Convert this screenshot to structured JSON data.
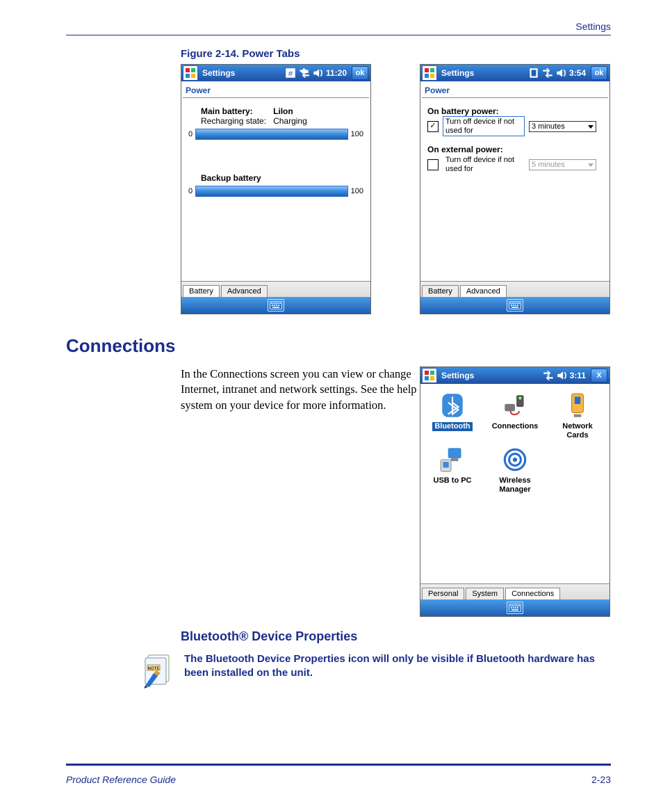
{
  "header": {
    "right": "Settings"
  },
  "figure": {
    "caption": "Figure 2-14. Power Tabs"
  },
  "screen_battery": {
    "title": "Settings",
    "time": "11:20",
    "ok": "ok",
    "section": "Power",
    "main_label": "Main battery:",
    "main_type": "LiIon",
    "recharge_label": "Recharging state:",
    "recharge_value": "Charging",
    "scale_min": "0",
    "scale_max": "100",
    "backup_label": "Backup battery",
    "tabs": [
      "Battery",
      "Advanced"
    ],
    "active_tab": 0
  },
  "screen_advanced": {
    "title": "Settings",
    "time": "3:54",
    "ok": "ok",
    "section": "Power",
    "bat_label": "On battery power:",
    "bat_option": "Turn off device if not used for",
    "bat_select": "3 minutes",
    "ext_label": "On external power:",
    "ext_option": "Turn off device if not used for",
    "ext_select": "5 minutes",
    "tabs": [
      "Battery",
      "Advanced"
    ],
    "active_tab": 1
  },
  "connections_heading": "Connections",
  "connections_body": "In the Connections screen you can view or change Internet, intranet and network settings. See the help system on your device for more information.",
  "screen_connections": {
    "title": "Settings",
    "time": "3:11",
    "close": "X",
    "icons": [
      {
        "label": "Bluetooth",
        "selected": true
      },
      {
        "label": "Connections",
        "selected": false
      },
      {
        "label": "Network Cards",
        "selected": false
      },
      {
        "label": "USB to PC",
        "selected": false
      },
      {
        "label": "Wireless Manager",
        "selected": false
      }
    ],
    "tabs": [
      "Personal",
      "System",
      "Connections"
    ],
    "active_tab": 2
  },
  "bt_heading": "Bluetooth® Device Properties",
  "note": {
    "badge": "NOTE",
    "text": "The Bluetooth Device Properties icon will only be visible if Bluetooth hardware has been installed on the unit."
  },
  "footer": {
    "left": "Product Reference Guide",
    "right": "2-23"
  }
}
